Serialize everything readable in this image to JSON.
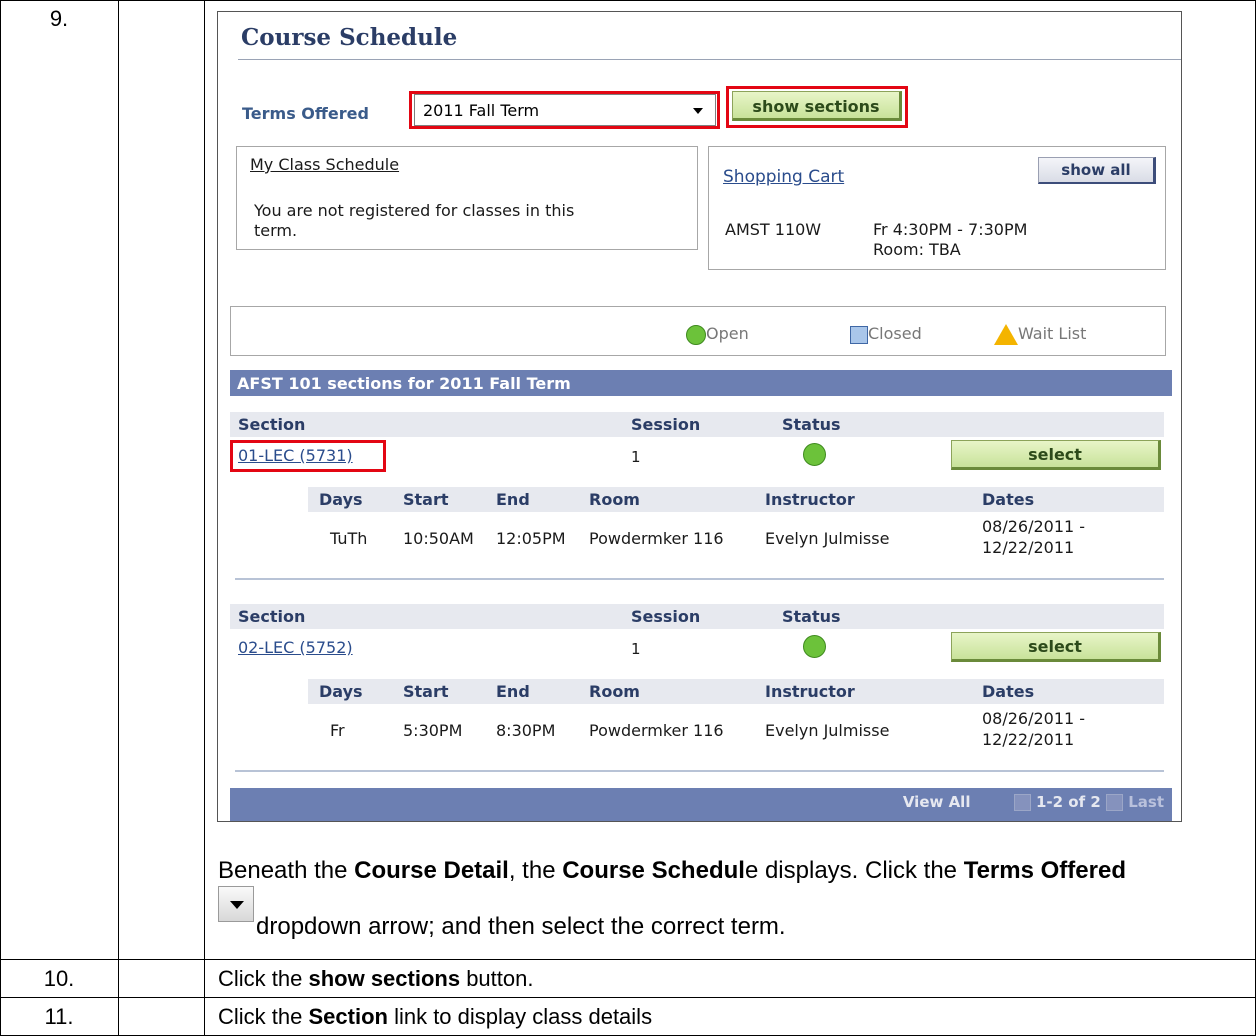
{
  "steps": [
    {
      "number": "9."
    },
    {
      "number": "10.",
      "text_prefix": "Click the ",
      "bold": "show sections",
      "text_suffix": " button."
    },
    {
      "number": "11.",
      "text_prefix": "Click the ",
      "bold": "Section",
      "text_suffix": " link to display class details"
    }
  ],
  "step9_text": {
    "p1": "Beneath the ",
    "b1": "Course Detail",
    "p2": ", the ",
    "b2": "Course Schedul",
    "p3": "e displays. Click the ",
    "b3": "Terms Offered",
    "line2": "dropdown arrow; and then select the correct term."
  },
  "course_schedule": {
    "title": "Course Schedule",
    "terms_label": "Terms Offered",
    "selected_term": "2011 Fall Term",
    "show_sections_label": "show sections",
    "my_class_schedule": {
      "link": "My Class Schedule",
      "message_line1": "You are not registered for classes in this",
      "message_line2": "term."
    },
    "shopping_cart": {
      "link": "Shopping Cart",
      "show_all_label": "show all",
      "course": "AMST 110W",
      "time": "Fr 4:30PM - 7:30PM",
      "room": "Room:  TBA"
    },
    "legend": {
      "open": "Open",
      "closed": "Closed",
      "wait_list": "Wait List"
    },
    "sections_header": "AFST 101 sections for 2011 Fall Term",
    "section_headers": {
      "section": "Section",
      "session": "Session",
      "status": "Status"
    },
    "meeting_headers": {
      "days": "Days",
      "start": "Start",
      "end": "End",
      "room": "Room",
      "instructor": "Instructor",
      "dates": "Dates"
    },
    "select_label": "select",
    "sections": [
      {
        "id": "01-LEC (5731)",
        "session": "1",
        "status": "Open",
        "days": "TuTh",
        "start": "10:50AM",
        "end": "12:05PM",
        "room": "Powdermker 116",
        "instructor": "Evelyn Julmisse",
        "dates_line1": "08/26/2011 -",
        "dates_line2": "12/22/2011"
      },
      {
        "id": "02-LEC (5752)",
        "session": "1",
        "status": "Open",
        "days": "Fr",
        "start": "5:30PM",
        "end": "8:30PM",
        "room": "Powdermker 116",
        "instructor": "Evelyn Julmisse",
        "dates_line1": "08/26/2011 -",
        "dates_line2": "12/22/2011"
      }
    ],
    "pager": {
      "view_all": "View All",
      "range": "1-2 of 2",
      "last": "Last"
    }
  },
  "colors": {
    "highlight_red": "#e30613",
    "header_band": "#6c7fb2",
    "open_green": "#6cc23a"
  }
}
